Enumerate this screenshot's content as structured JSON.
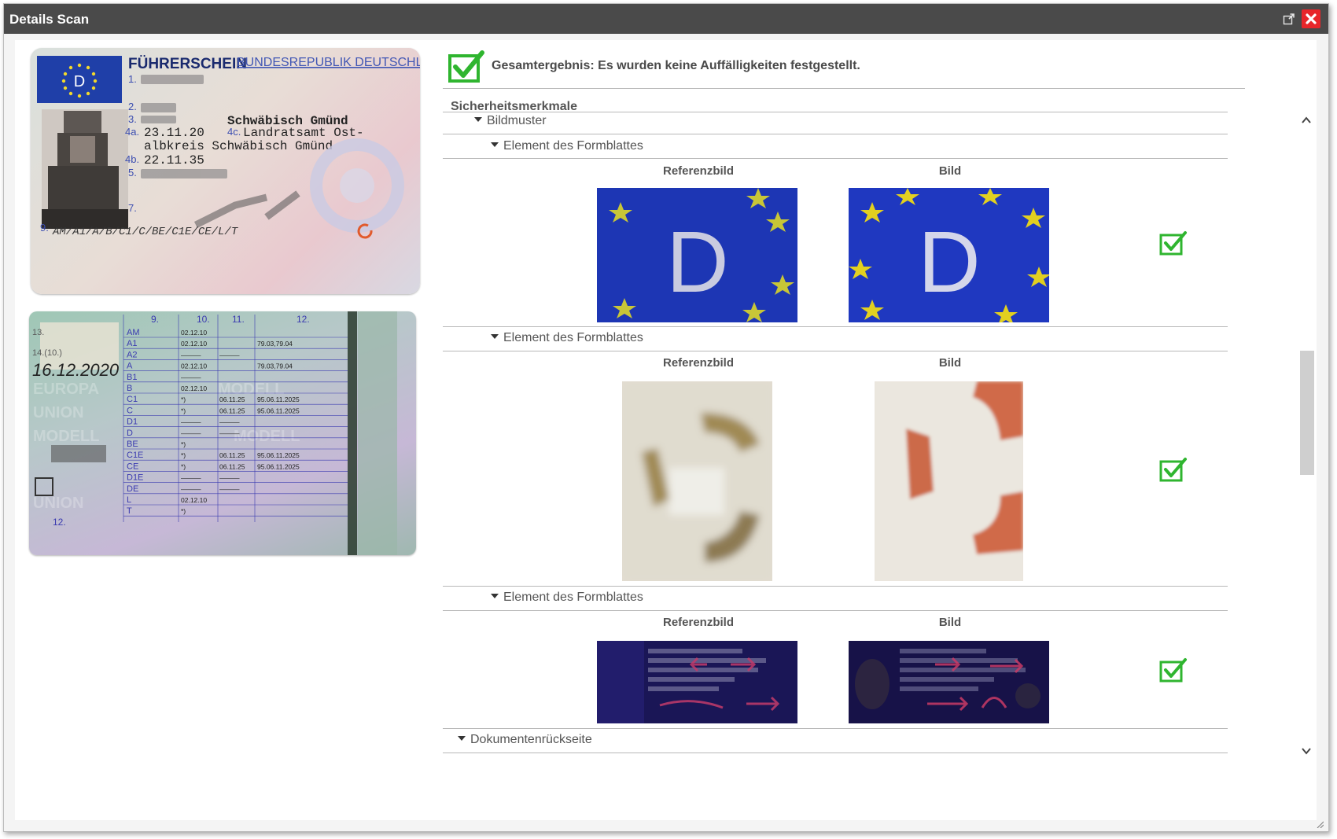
{
  "window": {
    "title": "Details Scan"
  },
  "summary": {
    "text": "Gesamtergebnis: Es wurden keine Auffälligkeiten festgestellt."
  },
  "section": {
    "title": "Sicherheitsmerkmale"
  },
  "tree": {
    "group": "Bildmuster",
    "elements": [
      {
        "label": "Element des Formblattes",
        "ref_label": "Referenzbild",
        "img_label": "Bild",
        "status": "ok"
      },
      {
        "label": "Element des Formblattes",
        "ref_label": "Referenzbild",
        "img_label": "Bild",
        "status": "ok"
      },
      {
        "label": "Element des Formblattes",
        "ref_label": "Referenzbild",
        "img_label": "Bild",
        "status": "ok"
      }
    ],
    "next_group": "Dokumentenrückseite"
  },
  "document_front": {
    "heading": "FÜHRERSCHEIN",
    "country": "BUNDESREPUBLIK DEUTSCHLAND",
    "country_code": "D",
    "fields": {
      "n1": "1.",
      "n2": "2.",
      "n3": "3.",
      "place": "Schwäbisch Gmünd",
      "n4a": "4a.",
      "issue_date": "23.11.20",
      "n4c": "4c.",
      "authority_1": "Landratsamt Ost-",
      "authority_2": "albkreis Schwäbisch Gmünd",
      "n4b": "4b.",
      "expiry_date": "22.11.35",
      "n5": "5.",
      "n7": "7.",
      "n9": "9.",
      "categories": "AM/A1/A/B/C1/C/BE/C1E/CE/L/T"
    }
  },
  "document_back": {
    "headers": [
      "9.",
      "10.",
      "11.",
      "12."
    ],
    "side_labels": {
      "n13": "13.",
      "n14": "14.(10.)",
      "n12": "12."
    },
    "handwritten_date": "16.12.2020",
    "rows": [
      {
        "cat": "AM",
        "d10": "02.12.10",
        "d11": "",
        "d12": ""
      },
      {
        "cat": "A1",
        "d10": "02.12.10",
        "d11": "",
        "d12": "79.03,79.04"
      },
      {
        "cat": "A2",
        "d10": "———",
        "d11": "———",
        "d12": ""
      },
      {
        "cat": "A",
        "d10": "02.12.10",
        "d11": "",
        "d12": "79.03,79.04"
      },
      {
        "cat": "B1",
        "d10": "———",
        "d11": "",
        "d12": ""
      },
      {
        "cat": "B",
        "d10": "02.12.10",
        "d11": "",
        "d12": ""
      },
      {
        "cat": "C1",
        "d10": "*)",
        "d11": "06.11.25",
        "d12": "95.06.11.2025"
      },
      {
        "cat": "C",
        "d10": "*)",
        "d11": "06.11.25",
        "d12": "95.06.11.2025"
      },
      {
        "cat": "D1",
        "d10": "———",
        "d11": "———",
        "d12": ""
      },
      {
        "cat": "D",
        "d10": "———",
        "d11": "———",
        "d12": ""
      },
      {
        "cat": "BE",
        "d10": "*)",
        "d11": "",
        "d12": ""
      },
      {
        "cat": "C1E",
        "d10": "*)",
        "d11": "06.11.25",
        "d12": "95.06.11.2025"
      },
      {
        "cat": "CE",
        "d10": "*)",
        "d11": "06.11.25",
        "d12": "95.06.11.2025"
      },
      {
        "cat": "D1E",
        "d10": "———",
        "d11": "———",
        "d12": ""
      },
      {
        "cat": "DE",
        "d10": "———",
        "d11": "———",
        "d12": ""
      },
      {
        "cat": "L",
        "d10": "02.12.10",
        "d11": "",
        "d12": ""
      },
      {
        "cat": "T",
        "d10": "*)",
        "d11": "",
        "d12": ""
      }
    ]
  },
  "samples": {
    "letter": "D"
  },
  "colors": {
    "accent_green": "#2fb52f",
    "eu_blue": "#1d36b4",
    "star_yellow": "#e7d321",
    "close_red": "#e8262a"
  }
}
